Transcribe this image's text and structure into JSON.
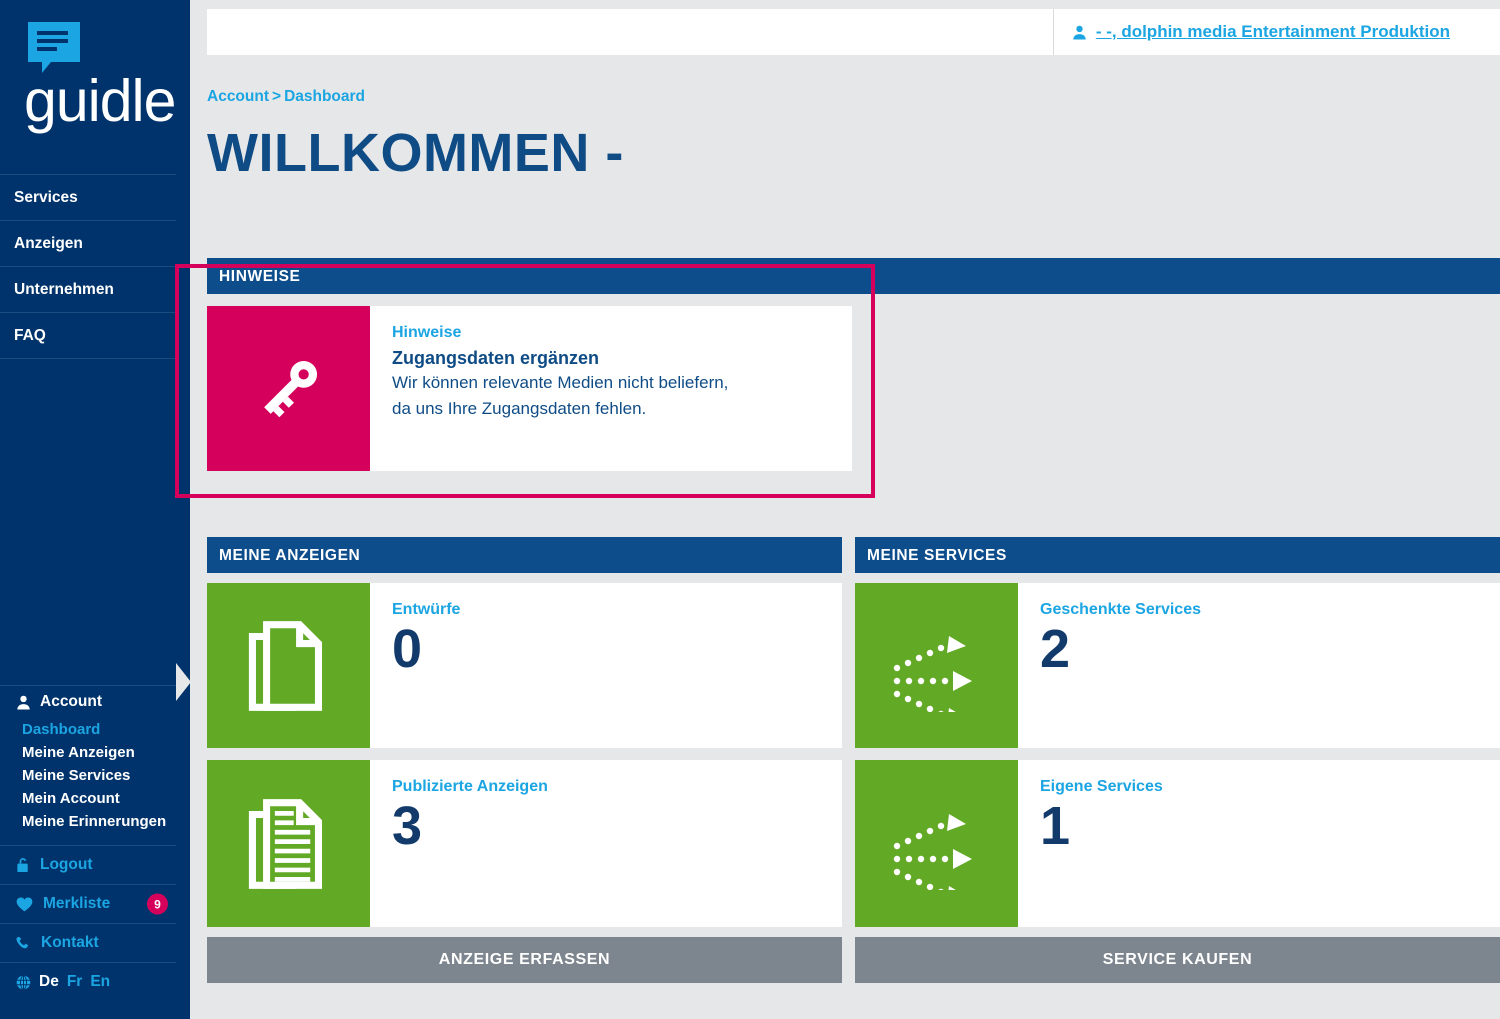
{
  "brand": {
    "name": "guidle",
    "logo_icon": "speech-bubble-icon",
    "sidebar_bg": "#00336b",
    "accent_blue": "#1ba5e2",
    "accent_pink": "#d5005b",
    "accent_green": "#62aa26"
  },
  "sidebar": {
    "primary_nav": [
      {
        "label": "Services"
      },
      {
        "label": "Anzeigen"
      },
      {
        "label": "Unternehmen"
      },
      {
        "label": "FAQ"
      }
    ],
    "account": {
      "icon": "user-icon",
      "label": "Account",
      "items": [
        {
          "label": "Dashboard",
          "active": true
        },
        {
          "label": "Meine Anzeigen",
          "active": false
        },
        {
          "label": "Meine Services",
          "active": false
        },
        {
          "label": "Mein Account",
          "active": false
        },
        {
          "label": "Meine Erinnerungen",
          "active": false
        }
      ]
    },
    "logout": {
      "icon": "lock-icon",
      "label": "Logout"
    },
    "merkliste": {
      "icon": "heart-icon",
      "label": "Merkliste",
      "badge": "9"
    },
    "kontakt": {
      "icon": "phone-icon",
      "label": "Kontakt"
    },
    "language": {
      "icon": "globe-icon",
      "options": [
        {
          "code": "De",
          "selected": true
        },
        {
          "code": "Fr",
          "selected": false
        },
        {
          "code": "En",
          "selected": false
        }
      ]
    }
  },
  "topbar": {
    "user_icon": "user-icon",
    "user_label": "- -, dolphin media Entertainment Produktion"
  },
  "breadcrumb": {
    "account": "Account",
    "separator": ">",
    "current": "Dashboard"
  },
  "page_title": "WILLKOMMEN -",
  "panels": {
    "hinweise": {
      "header": "HINWEISE",
      "card": {
        "icon": "key-icon",
        "kicker": "Hinweise",
        "title": "Zugangsdaten ergänzen",
        "description_line1": "Wir können relevante Medien nicht beliefern,",
        "description_line2": "da uns Ihre Zugangsdaten fehlen."
      },
      "highlighted": true
    },
    "meine_anzeigen": {
      "header": "MEINE ANZEIGEN",
      "cards": [
        {
          "icon": "blank-document-icon",
          "label": "Entwürfe",
          "count": "0"
        },
        {
          "icon": "lined-document-icon",
          "label": "Publizierte Anzeigen",
          "count": "3"
        }
      ],
      "cta": "ANZEIGE ERFASSEN"
    },
    "meine_services": {
      "header": "MEINE SERVICES",
      "cards": [
        {
          "icon": "distribution-arrows-icon",
          "label": "Geschenkte Services",
          "count": "2"
        },
        {
          "icon": "distribution-arrows-icon",
          "label": "Eigene Services",
          "count": "1"
        }
      ],
      "cta": "SERVICE KAUFEN"
    }
  }
}
